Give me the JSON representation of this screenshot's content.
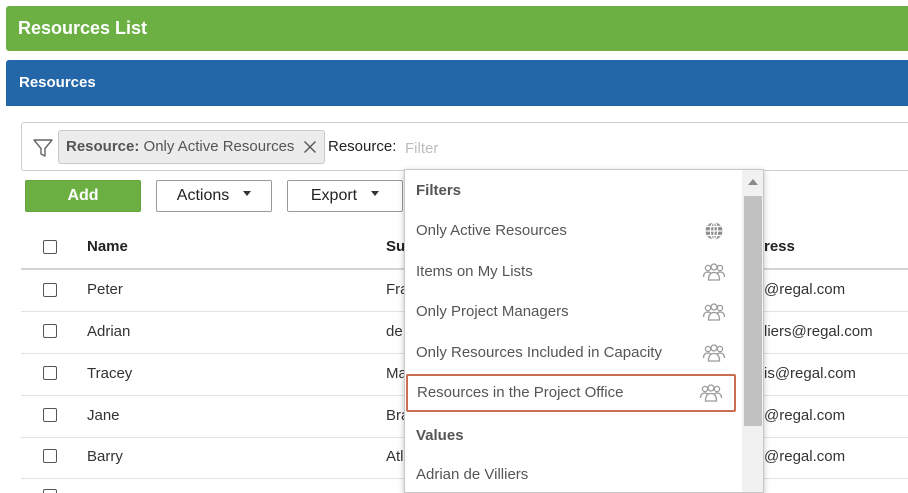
{
  "app": {
    "title": "Resources List"
  },
  "section": {
    "title": "Resources"
  },
  "filter": {
    "chip_key": "Resource:",
    "chip_value": "Only Active Resources",
    "label": "Resource:",
    "placeholder": "Filter"
  },
  "toolbar": {
    "add_label": "Add",
    "actions_label": "Actions",
    "export_label": "Export"
  },
  "table": {
    "headers": {
      "name": "Name",
      "surname": "Su",
      "email": "ress"
    },
    "rows": [
      {
        "name": "Peter",
        "surname": "Fra",
        "email": "@regal.com"
      },
      {
        "name": "Adrian",
        "surname": "de",
        "email": "liers@regal.com"
      },
      {
        "name": "Tracey",
        "surname": "Ma",
        "email": "is@regal.com"
      },
      {
        "name": "Jane",
        "surname": "Bra",
        "email": "@regal.com"
      },
      {
        "name": "Barry",
        "surname": "Atl",
        "email": "@regal.com"
      }
    ]
  },
  "dropdown": {
    "filters_heading": "Filters",
    "filters": [
      {
        "label": "Only Active Resources",
        "icon": "globe-icon"
      },
      {
        "label": "Items on My Lists",
        "icon": "people-icon"
      },
      {
        "label": "Only Project Managers",
        "icon": "people-icon"
      },
      {
        "label": "Only Resources Included in Capacity",
        "icon": "people-icon"
      },
      {
        "label": "Resources in the Project Office",
        "icon": "people-icon",
        "highlighted": true
      }
    ],
    "values_heading": "Values",
    "values": [
      {
        "label": "Adrian de Villiers"
      }
    ]
  },
  "colors": {
    "title_bar": "#6cb043",
    "section_bar": "#2467a8",
    "add_button": "#6cb043",
    "highlight_border": "#cc6d52"
  }
}
